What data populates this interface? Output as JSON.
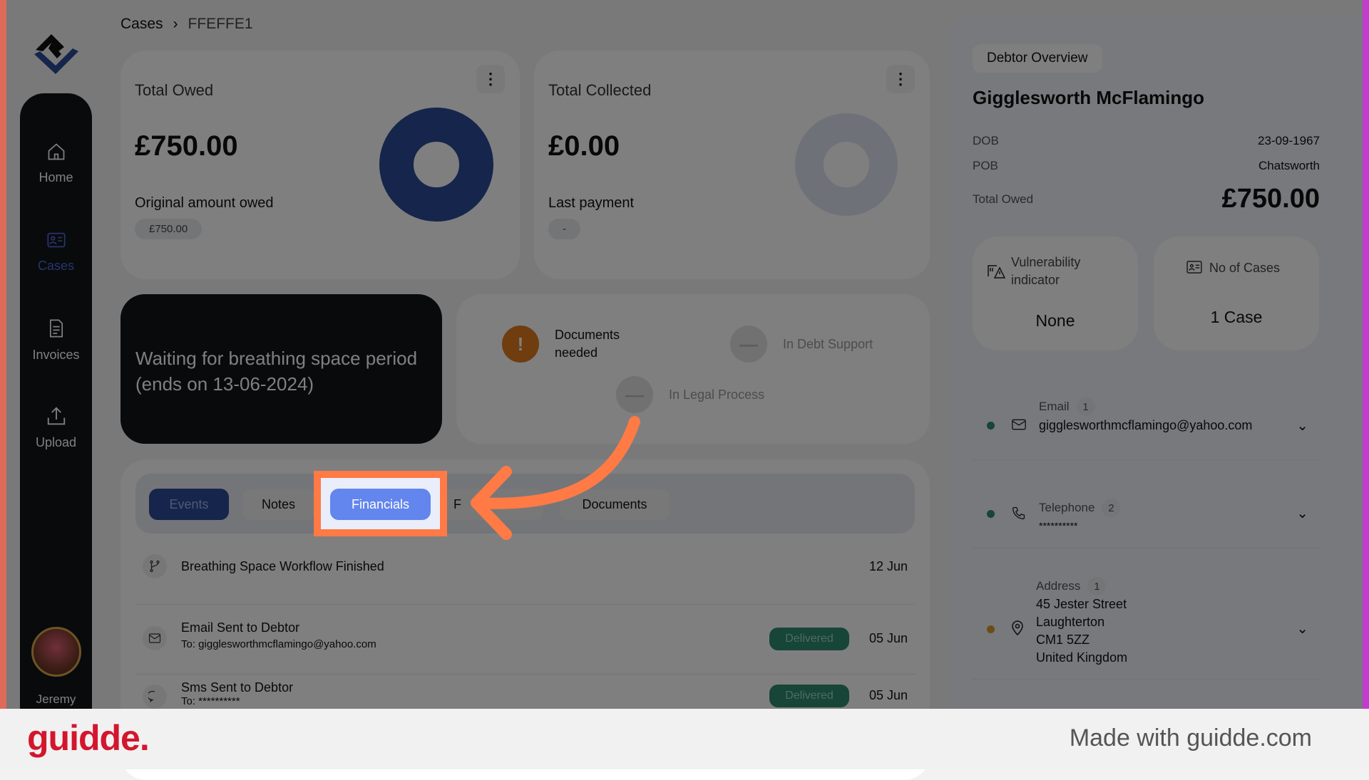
{
  "breadcrumb": {
    "parent": "Cases",
    "current": "FFEFFE1"
  },
  "sidebar": {
    "items": [
      {
        "label": "Home",
        "icon": "home-icon"
      },
      {
        "label": "Cases",
        "icon": "id-card-icon"
      },
      {
        "label": "Invoices",
        "icon": "invoice-icon"
      },
      {
        "label": "Upload",
        "icon": "upload-icon"
      }
    ],
    "user": "Jeremy",
    "active": "Cases"
  },
  "total_owed": {
    "title": "Total Owed",
    "amount": "£750.00",
    "sub_label": "Original amount owed",
    "sub_value": "£750.00",
    "color": "#2c4a96"
  },
  "total_collected": {
    "title": "Total Collected",
    "amount": "£0.00",
    "sub_label": "Last payment",
    "sub_value": "-"
  },
  "banner": {
    "text": "Waiting for breathing space period (ends on 13-06-2024)"
  },
  "statuses": [
    {
      "label": "Documents needed",
      "state": "active",
      "icon": "!",
      "color": "#e07a1f"
    },
    {
      "label": "In Debt Support",
      "state": "inactive"
    },
    {
      "label": "In Legal Process",
      "state": "inactive"
    }
  ],
  "tabs": [
    {
      "label": "Events",
      "active": true
    },
    {
      "label": "Notes"
    },
    {
      "label": "Financials",
      "highlighted": true
    },
    {
      "label": "F"
    },
    {
      "label": "Documents"
    }
  ],
  "events": [
    {
      "icon": "workflow-icon",
      "title": "Breathing Space Workflow Finished",
      "sub": "",
      "badge": "",
      "date": "12 Jun"
    },
    {
      "icon": "mail-icon",
      "title": "Email Sent to Debtor",
      "sub": "To: gigglesworthmcflamingo@yahoo.com",
      "badge": "Delivered",
      "date": "05 Jun"
    },
    {
      "icon": "sms-icon",
      "title": "Sms Sent to Debtor",
      "sub": "To: **********",
      "badge": "Delivered",
      "date": "05 Jun"
    }
  ],
  "debtor": {
    "tag": "Debtor Overview",
    "name": "Gigglesworth McFlamingo",
    "dob_label": "DOB",
    "dob": "23-09-1967",
    "pob_label": "POB",
    "pob": "Chatsworth",
    "owed_label": "Total Owed",
    "owed": "£750.00",
    "vuln_label": "Vulnerability indicator",
    "vuln_value": "None",
    "cases_label": "No of Cases",
    "cases_value": "1 Case",
    "email": {
      "label": "Email",
      "count": "1",
      "value": "gigglesworthmcflamingo@yahoo.com"
    },
    "telephone": {
      "label": "Telephone",
      "count": "2",
      "value": "**********"
    },
    "address": {
      "label": "Address",
      "count": "1",
      "lines": [
        "45 Jester Street",
        "Laughterton",
        "CM1 5ZZ",
        "United Kingdom"
      ]
    }
  },
  "footer": {
    "logo": "guidde.",
    "text": "Made with guidde.com"
  },
  "colors": {
    "accent": "#6385ee",
    "highlight": "#ff7a45",
    "delivered": "#2e8b6e"
  }
}
